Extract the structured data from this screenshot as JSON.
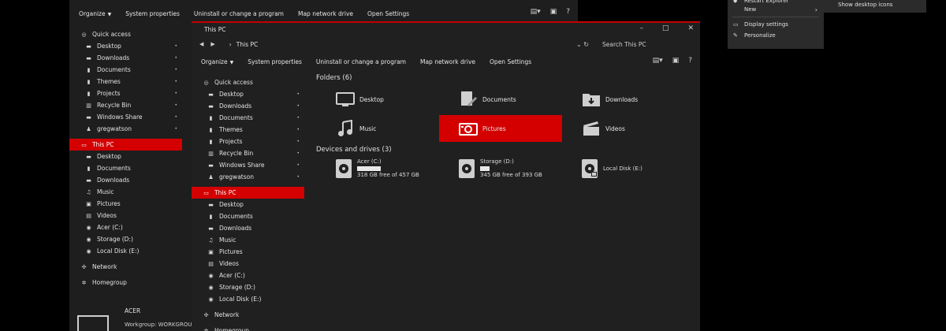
{
  "colors": {
    "accent": "#d40000",
    "background": "#000000",
    "window": "#1e1e1e",
    "text": "#e6e6e6"
  },
  "back_window": {
    "toolbar": [
      "Organize",
      "System properties",
      "Uninstall or change a program",
      "Map network drive",
      "Open Settings"
    ],
    "nav": [
      {
        "label": "Quick access",
        "icon": "star-icon",
        "level": 0,
        "pinned": false,
        "selected": false
      },
      {
        "label": "Desktop",
        "icon": "folder-icon",
        "level": 1,
        "pinned": true,
        "selected": false
      },
      {
        "label": "Downloads",
        "icon": "folder-icon",
        "level": 1,
        "pinned": true,
        "selected": false
      },
      {
        "label": "Documents",
        "icon": "document-icon",
        "level": 1,
        "pinned": true,
        "selected": false
      },
      {
        "label": "Themes",
        "icon": "document-icon",
        "level": 1,
        "pinned": true,
        "selected": false
      },
      {
        "label": "Projects",
        "icon": "document-icon",
        "level": 1,
        "pinned": true,
        "selected": false
      },
      {
        "label": "Recycle Bin",
        "icon": "trash-icon",
        "level": 1,
        "pinned": true,
        "selected": false
      },
      {
        "label": "Windows Share",
        "icon": "folder-icon",
        "level": 1,
        "pinned": true,
        "selected": false
      },
      {
        "label": "gregwatson",
        "icon": "user-icon",
        "level": 1,
        "pinned": true,
        "selected": false
      },
      {
        "gap": true
      },
      {
        "label": "This PC",
        "icon": "monitor-icon",
        "level": 0,
        "pinned": false,
        "selected": true
      },
      {
        "label": "Desktop",
        "icon": "folder-icon",
        "level": 1,
        "pinned": false,
        "selected": false
      },
      {
        "label": "Documents",
        "icon": "document-icon",
        "level": 1,
        "pinned": false,
        "selected": false
      },
      {
        "label": "Downloads",
        "icon": "folder-icon",
        "level": 1,
        "pinned": false,
        "selected": false
      },
      {
        "label": "Music",
        "icon": "music-icon",
        "level": 1,
        "pinned": false,
        "selected": false
      },
      {
        "label": "Pictures",
        "icon": "picture-icon",
        "level": 1,
        "pinned": false,
        "selected": false
      },
      {
        "label": "Videos",
        "icon": "video-icon",
        "level": 1,
        "pinned": false,
        "selected": false
      },
      {
        "label": "Acer (C:)",
        "icon": "drive-icon",
        "level": 1,
        "pinned": false,
        "selected": false
      },
      {
        "label": "Storage (D:)",
        "icon": "drive-icon",
        "level": 1,
        "pinned": false,
        "selected": false
      },
      {
        "label": "Local Disk (E:)",
        "icon": "drive-icon",
        "level": 1,
        "pinned": false,
        "selected": false
      },
      {
        "gap": true
      },
      {
        "label": "Network",
        "icon": "network-icon",
        "level": 0,
        "pinned": false,
        "selected": false
      },
      {
        "gap": true
      },
      {
        "label": "Homegroup",
        "icon": "homegroup-icon",
        "level": 0,
        "pinned": false,
        "selected": false
      }
    ],
    "computer_name": "ACER",
    "workgroup": "Workgroup:   WORKGROUP"
  },
  "front_window": {
    "title": "This PC",
    "path": "This PC",
    "search_placeholder": "Search This PC",
    "toolbar": [
      "Organize",
      "System properties",
      "Uninstall or change a program",
      "Map network drive",
      "Open Settings"
    ],
    "nav": [
      {
        "label": "Quick access",
        "icon": "star-icon",
        "level": 0,
        "pinned": false,
        "selected": false
      },
      {
        "label": "Desktop",
        "icon": "folder-icon",
        "level": 1,
        "pinned": true,
        "selected": false
      },
      {
        "label": "Downloads",
        "icon": "folder-icon",
        "level": 1,
        "pinned": true,
        "selected": false
      },
      {
        "label": "Documents",
        "icon": "document-icon",
        "level": 1,
        "pinned": true,
        "selected": false
      },
      {
        "label": "Themes",
        "icon": "document-icon",
        "level": 1,
        "pinned": true,
        "selected": false
      },
      {
        "label": "Projects",
        "icon": "document-icon",
        "level": 1,
        "pinned": true,
        "selected": false
      },
      {
        "label": "Recycle Bin",
        "icon": "trash-icon",
        "level": 1,
        "pinned": true,
        "selected": false
      },
      {
        "label": "Windows Share",
        "icon": "folder-icon",
        "level": 1,
        "pinned": true,
        "selected": false
      },
      {
        "label": "gregwatson",
        "icon": "user-icon",
        "level": 1,
        "pinned": true,
        "selected": false
      },
      {
        "gap": true
      },
      {
        "label": "This PC",
        "icon": "monitor-icon",
        "level": 0,
        "pinned": false,
        "selected": true
      },
      {
        "label": "Desktop",
        "icon": "folder-icon",
        "level": 1,
        "pinned": false,
        "selected": false
      },
      {
        "label": "Documents",
        "icon": "document-icon",
        "level": 1,
        "pinned": false,
        "selected": false
      },
      {
        "label": "Downloads",
        "icon": "folder-icon",
        "level": 1,
        "pinned": false,
        "selected": false
      },
      {
        "label": "Music",
        "icon": "music-icon",
        "level": 1,
        "pinned": false,
        "selected": false
      },
      {
        "label": "Pictures",
        "icon": "picture-icon",
        "level": 1,
        "pinned": false,
        "selected": false
      },
      {
        "label": "Videos",
        "icon": "video-icon",
        "level": 1,
        "pinned": false,
        "selected": false
      },
      {
        "label": "Acer (C:)",
        "icon": "drive-icon",
        "level": 1,
        "pinned": false,
        "selected": false
      },
      {
        "label": "Storage (D:)",
        "icon": "drive-icon",
        "level": 1,
        "pinned": false,
        "selected": false
      },
      {
        "label": "Local Disk (E:)",
        "icon": "drive-icon",
        "level": 1,
        "pinned": false,
        "selected": false
      },
      {
        "gap": true
      },
      {
        "label": "Network",
        "icon": "network-icon",
        "level": 0,
        "pinned": false,
        "selected": false
      },
      {
        "gap": true
      },
      {
        "label": "Homegroup",
        "icon": "homegroup-icon",
        "level": 0,
        "pinned": false,
        "selected": false
      }
    ],
    "folders_heading": "Folders (6)",
    "folders": [
      {
        "label": "Desktop",
        "icon": "desktop-icon",
        "selected": false
      },
      {
        "label": "Documents",
        "icon": "documents-icon",
        "selected": false
      },
      {
        "label": "Downloads",
        "icon": "downloads-icon",
        "selected": false
      },
      {
        "label": "Music",
        "icon": "music-icon",
        "selected": false
      },
      {
        "label": "Pictures",
        "icon": "camera-icon",
        "selected": true
      },
      {
        "label": "Videos",
        "icon": "clapperboard-icon",
        "selected": false
      }
    ],
    "drives_heading": "Devices and drives (3)",
    "drives": [
      {
        "label": "Acer (C:)",
        "free": "318 GB free of 457 GB",
        "fill": 0.3
      },
      {
        "label": "Storage (D:)",
        "free": "345 GB free of 393 GB",
        "fill": 0.12
      },
      {
        "label": "Local Disk (E:)",
        "free": "",
        "fill": null
      }
    ]
  },
  "context_menu": {
    "items": [
      {
        "label": "Restart Explorer",
        "icon": "shield-icon",
        "submenu": false
      },
      {
        "label": "New",
        "icon": "",
        "submenu": true
      },
      {
        "label": "Display settings",
        "icon": "monitor-icon",
        "submenu": false
      },
      {
        "label": "Personalize",
        "icon": "brush-icon",
        "submenu": false
      }
    ],
    "submenu_item": "Show desktop icons"
  }
}
